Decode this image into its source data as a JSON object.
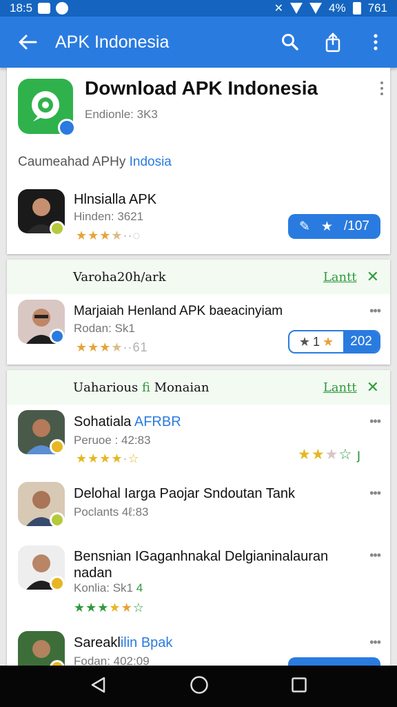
{
  "status_bar": {
    "time": "18:5",
    "battery_pct": "4%",
    "right_text": "761"
  },
  "app_bar": {
    "title": "APK Indonesia",
    "icons": [
      "back-arrow-icon",
      "search-icon",
      "share-icon",
      "more-vertical-icon"
    ]
  },
  "hero": {
    "title": "Download APK Indonesia",
    "subtitle": "Endionle: 3K3",
    "caption_prefix": "Caumeahad APHy",
    "caption_accent": "Indosia",
    "item": {
      "title": "Hlnsialla APK",
      "subtitle": "Hinden: 3621",
      "rating": 3.5,
      "stars_text": "★★★★··◌",
      "pill_value": "/107"
    }
  },
  "section1": {
    "title": "Varoha20h/ark",
    "link": "Lantt",
    "item": {
      "title": "Marjaiah Henland APK baeacinyiam",
      "subtitle": "Rodan: Sk1",
      "stars_text": "★★★★··61",
      "pill_left": "1",
      "pill_value": "202"
    }
  },
  "section2": {
    "title_prefix": "Uaharious",
    "title_accent": "fi",
    "title_suffix": "Monaian",
    "link": "Lantt",
    "items": [
      {
        "title_prefix": "Sohatiala",
        "title_accent": "AFRBR",
        "subtitle": "Peruoe : 42:83",
        "stars_text": "★★★★·☆",
        "trailing_stars": "★★★☆",
        "trailing_mark": "ȷ"
      },
      {
        "title": "Delohal Iarga Paojar Sndoutan Tank",
        "subtitle": "Poclants 4ℓ:83"
      },
      {
        "title_line1": "Bensnian IGaganhnakal Delgianinalauran",
        "title_line2": "nadan",
        "subtitle": "Konlia: Sk1",
        "subtitle_accent": "4",
        "stars_text": "★★★★★☆"
      },
      {
        "title_prefix": "Sareakl",
        "title_accent": "ilin Bpak",
        "subtitle": "Fodan: 402:09"
      }
    ]
  },
  "colors": {
    "primary": "#2a7be0",
    "status_bar": "#1565c0",
    "green": "#2e9a3b",
    "star": "#e8a23a"
  },
  "nav_bar": {
    "icons": [
      "back-triangle-icon",
      "home-circle-icon",
      "recents-square-icon"
    ]
  }
}
